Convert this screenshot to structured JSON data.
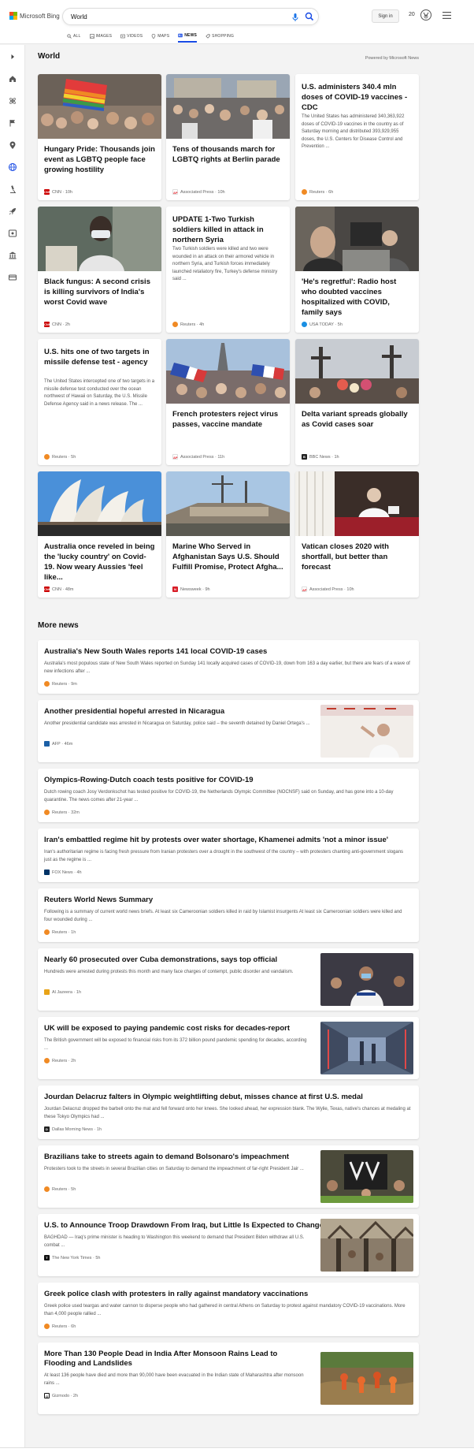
{
  "header": {
    "logo_text": "Microsoft Bing",
    "search_value": "World",
    "sign_in_label": "Sign in",
    "points": "20"
  },
  "tabs": [
    {
      "label": "ALL",
      "icon": "search-icon"
    },
    {
      "label": "IMAGES",
      "icon": "image-icon"
    },
    {
      "label": "VIDEOS",
      "icon": "video-icon"
    },
    {
      "label": "MAPS",
      "icon": "map-pin-icon"
    },
    {
      "label": "NEWS",
      "icon": "news-icon",
      "active": true
    },
    {
      "label": "SHOPPING",
      "icon": "shopping-tag-icon"
    }
  ],
  "sidebar": [
    "expand-icon",
    "home-icon",
    "science-icon",
    "flag-icon",
    "location-icon",
    "globe-icon",
    "microscope-icon",
    "rocket-icon",
    "entertainment-icon",
    "politics-icon",
    "money-icon"
  ],
  "section": {
    "title": "World",
    "powered_by": "Powered by Microsoft News"
  },
  "cards": [
    {
      "title": "Hungary Pride: Thousands join event as LGBTQ people face growing hostility",
      "source": "CNN",
      "age": "10h"
    },
    {
      "title": "Tens of thousands march for LGBTQ rights at Berlin parade",
      "source": "Associated Press",
      "age": "10h"
    },
    {
      "title": "U.S. administers 340.4 mln doses of COVID-19 vaccines - CDC",
      "snippet": "The United States has administered 340,363,922 doses of COVID-19 vaccines in the country as of Saturday morning and distributed 393,929,955 doses, the U.S. Centers for Disease Control and Prevention ...",
      "source": "Reuters",
      "age": "6h"
    },
    {
      "title": "Black fungus: A second crisis is killing survivors of India's worst Covid wave",
      "source": "CNN",
      "age": "2h"
    },
    {
      "title": "UPDATE 1-Two Turkish soldiers killed in attack in northern Syria",
      "snippet": "Two Turkish soldiers were killed and two were wounded in an attack on their armored vehicle in northern Syria, and Turkish forces immediately launched retaliatory fire, Turkey's defense ministry said ...",
      "source": "Reuters",
      "age": "4h"
    },
    {
      "title": "'He's regretful': Radio host who doubted vaccines hospitalized with COVID, family says",
      "source": "USA TODAY",
      "age": "5h"
    },
    {
      "title": "U.S. hits one of two targets in missile defense test - agency",
      "snippet": "The United States intercepted one of two targets in a missile defense test conducted over the ocean northwest of Hawaii on Saturday, the U.S. Missile Defense Agency said in a news release. The ...",
      "source": "Reuters",
      "age": "5h"
    },
    {
      "title": "French protesters reject virus passes, vaccine mandate",
      "source": "Associated Press",
      "age": "11h"
    },
    {
      "title": "Delta variant spreads globally as Covid cases soar",
      "source": "BBC News",
      "age": "1h"
    },
    {
      "title": "Australia once reveled in being the 'lucky country' on Covid-19. Now weary Aussies 'feel like...",
      "source": "CNN",
      "age": "48m"
    },
    {
      "title": "Marine Who Served in Afghanistan Says U.S. Should Fulfill Promise, Protect Afgha...",
      "source": "Newsweek",
      "age": "9h"
    },
    {
      "title": "Vatican closes 2020 with shortfall, but better than forecast",
      "source": "Associated Press",
      "age": "10h"
    }
  ],
  "more_news_title": "More news",
  "more_news": [
    {
      "title": "Australia's New South Wales reports 141 local COVID-19 cases",
      "snippet": "Australia's most populous state of New South Wales reported on Sunday 141 locally acquired cases of COVID-19, down from 163 a day earlier, but there are fears of a wave of new infections after ...",
      "source": "Reuters",
      "age": "9m"
    },
    {
      "title": "Another presidential hopeful arrested in Nicaragua",
      "snippet": "Another presidential candidate was arrested in Nicaragua on Saturday, police said – the seventh detained by Daniel Ortega's ...",
      "source": "AFP",
      "age": "46m"
    },
    {
      "title": "Olympics-Rowing-Dutch coach tests positive for COVID-19",
      "snippet": "Dutch rowing coach Josy Verdonkschot has tested positive for COVID-19, the Netherlands Olympic Committee (NOCNSF) said on Sunday, and has gone into a 10-day quarantine. The news comes after 21-year ...",
      "source": "Reuters",
      "age": "32m"
    },
    {
      "title": "Iran's embattled regime hit by protests over water shortage, Khamenei admits 'not a minor issue'",
      "snippet": "Iran's authoritarian regime is facing fresh pressure from Iranian protesters over a drought in the southwest of the country – with protesters chanting anti-government slogans just as the regime is ...",
      "source": "FOX News",
      "age": "4h"
    },
    {
      "title": "Reuters World News Summary",
      "snippet": "Following is a summary of current world news briefs. At least six Cameroonian soldiers killed in raid by Islamist insurgents At least six Cameroonian soldiers were killed and four wounded during ...",
      "source": "Reuters",
      "age": "1h"
    },
    {
      "title": "Nearly 60 prosecuted over Cuba demonstrations, says top official",
      "snippet": "Hundreds were arrested during protests this month and many face charges of contempt, public disorder and vandalism.",
      "source": "Al Jazeera",
      "age": "1h"
    },
    {
      "title": "UK will be exposed to paying pandemic cost risks for decades-report",
      "snippet": "The British government will be exposed to financial risks from its 372 billion pound pandemic spending for decades, according ...",
      "source": "Reuters",
      "age": "2h"
    },
    {
      "title": "Jourdan Delacruz falters in Olympic weightlifting debut, misses chance at first U.S. medal",
      "snippet": "Jourdan Delacruz dropped the barbell onto the mat and fell forward onto her knees. She looked ahead, her expression blank. The Wylie, Texas, native's chances at medaling at these Tokyo Olympics had ...",
      "source": "Dallas Morning News",
      "age": "1h"
    },
    {
      "title": "Brazilians take to streets again to demand Bolsonaro's impeachment",
      "snippet": "Protesters took to the streets in several Brazilian cities on Saturday to demand the impeachment of far-right President Jair ...",
      "source": "Reuters",
      "age": "5h"
    },
    {
      "title": "U.S. to Announce Troop Drawdown From Iraq, but Little Is Expected to Change",
      "snippet": "BAGHDAD — Iraq's prime minister is heading to Washington this weekend to demand that President Biden withdraw all U.S. combat ...",
      "source": "The New York Times",
      "age": "5h"
    },
    {
      "title": "Greek police clash with protesters in rally against mandatory vaccinations",
      "snippet": "Greek police used teargas and water cannon to disperse people who had gathered in central Athens on Saturday to protest against mandatory COVID-19 vaccinations. More than 4,000 people rallied ...",
      "source": "Reuters",
      "age": "6h"
    },
    {
      "title": "More Than 130 People Dead in India After Monsoon Rains Lead to Flooding and Landslides",
      "snippet": "At least 136 people have died and more than 90,000 have been evacuated in the Indian state of Maharashtra after monsoon rains ...",
      "source": "Gizmodo",
      "age": "2h"
    }
  ],
  "colors": {
    "accent": "#174ae4",
    "cnn": "#cc0000",
    "reuters": "#f08a24",
    "ap": "#e41e26",
    "usatoday": "#1a8fe3",
    "bbc": "#222222",
    "newsweek": "#d81d27",
    "afp": "#1b5fa6",
    "fox": "#003366",
    "aljazeera": "#e8a317",
    "dallas": "#222222",
    "nyt": "#111111",
    "gizmodo": "#111111"
  }
}
